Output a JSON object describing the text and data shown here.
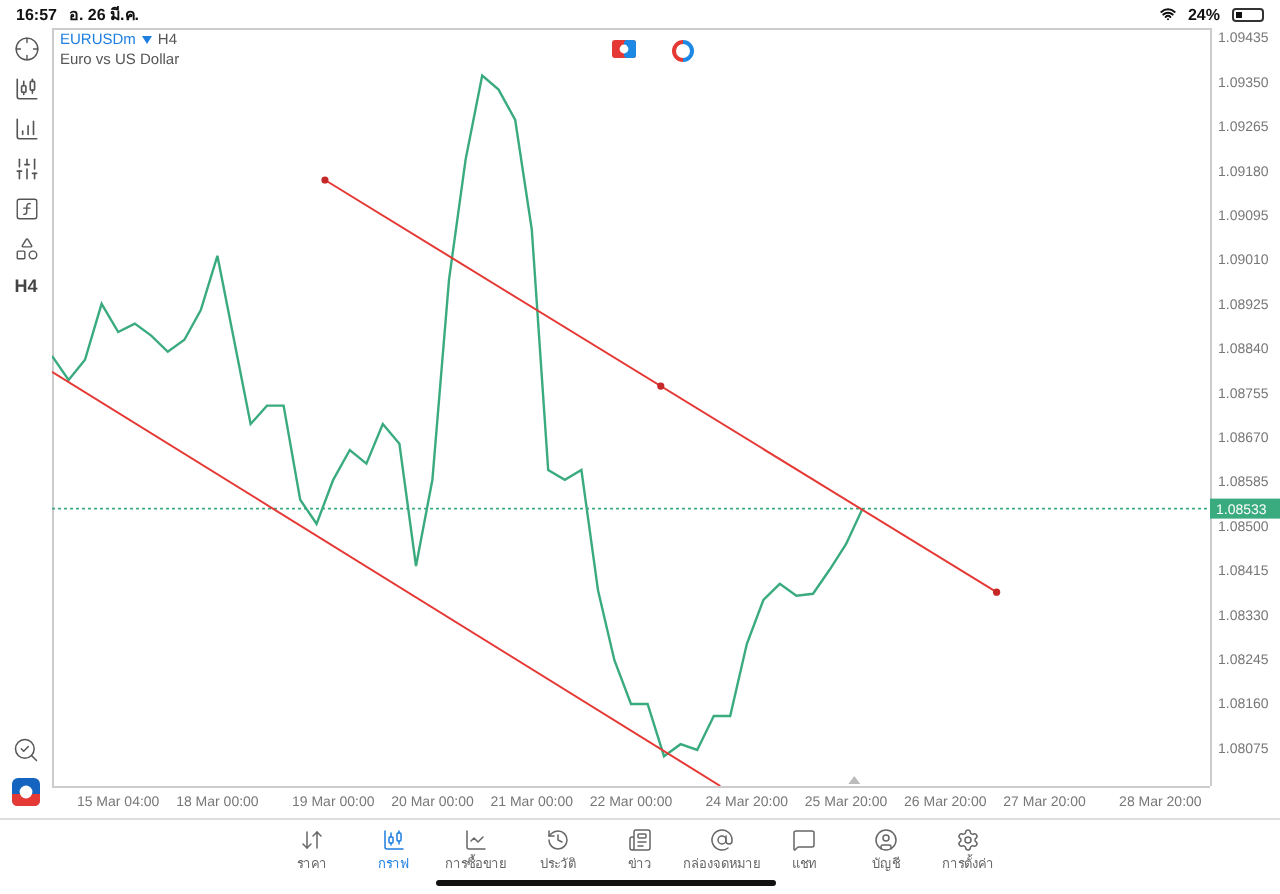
{
  "status_bar": {
    "time": "16:57",
    "date": "อ. 26 มี.ค.",
    "battery": "24%"
  },
  "toolbar": {
    "timeframe": "H4"
  },
  "chart": {
    "timeframe": "H4",
    "description": "Euro vs US Dollar",
    "trendlines": [
      {
        "handles": false
      },
      {
        "handles": true
      }
    ],
    "chart_data": {
      "type": "line",
      "series": [
        {
          "name": "EURUSDm",
          "color": "#3aaa7f",
          "values": [
            1.08825,
            1.08779,
            1.08818,
            1.08925,
            1.08871,
            1.08887,
            1.08864,
            1.08833,
            1.08856,
            1.08913,
            1.09017,
            1.08856,
            1.08695,
            1.0873,
            1.0873,
            1.0855,
            1.08504,
            1.08588,
            1.08645,
            1.08619,
            1.08695,
            1.08657,
            1.08423,
            1.08588,
            1.08971,
            1.09201,
            1.09362,
            1.09335,
            1.09277,
            1.09067,
            1.08607,
            1.08588,
            1.08607,
            1.08377,
            1.08243,
            1.08159,
            1.08159,
            1.08059,
            1.08082,
            1.08071,
            1.08136,
            1.08136,
            1.08274,
            1.08358,
            1.08389,
            1.08366,
            1.0837,
            1.08416,
            1.08465,
            1.08533,
            null,
            null,
            null,
            null,
            null,
            null,
            null,
            null,
            null,
            null,
            null,
            null,
            null,
            null,
            null,
            null,
            null,
            null,
            null,
            null,
            null
          ]
        }
      ],
      "categories": [
        null,
        null,
        null,
        null,
        "15 Mar 04:00",
        null,
        null,
        null,
        null,
        null,
        "18 Mar 00:00",
        null,
        null,
        null,
        null,
        null,
        null,
        "19 Mar 00:00",
        null,
        null,
        null,
        null,
        null,
        "20 Mar 00:00",
        null,
        null,
        null,
        null,
        null,
        "21 Mar 00:00",
        null,
        null,
        null,
        null,
        null,
        "22 Mar 00:00",
        null,
        null,
        null,
        null,
        null,
        null,
        "24 Mar 20:00",
        null,
        null,
        null,
        null,
        null,
        "25 Mar 20:00",
        null,
        null,
        null,
        null,
        null,
        "26 Mar 20:00",
        null,
        null,
        null,
        null,
        null,
        "27 Mar 20:00",
        null,
        null,
        null,
        null,
        null,
        null,
        "28 Mar 20:00",
        null,
        null,
        null
      ],
      "ylim": [
        1.08002,
        1.09453
      ],
      "yticks": [
        {
          "value": 1.09435,
          "label": "1.09435"
        },
        {
          "value": 1.0935,
          "label": "1.09350"
        },
        {
          "value": 1.09265,
          "label": "1.09265"
        },
        {
          "value": 1.0918,
          "label": "1.09180"
        },
        {
          "value": 1.09095,
          "label": "1.09095"
        },
        {
          "value": 1.0901,
          "label": "1.09010"
        },
        {
          "value": 1.08925,
          "label": "1.08925"
        },
        {
          "value": 1.0884,
          "label": "1.08840"
        },
        {
          "value": 1.08755,
          "label": "1.08755"
        },
        {
          "value": 1.0867,
          "label": "1.08670"
        },
        {
          "value": 1.08585,
          "label": "1.08585"
        },
        {
          "value": 1.085,
          "label": "1.08500"
        },
        {
          "value": 1.08415,
          "label": "1.08415"
        },
        {
          "value": 1.0833,
          "label": "1.08330"
        },
        {
          "value": 1.08245,
          "label": "1.08245"
        },
        {
          "value": 1.0816,
          "label": "1.08160"
        },
        {
          "value": 1.08075,
          "label": "1.08075"
        }
      ],
      "ref_lines": [
        {
          "axis": "y",
          "value": 1.08533,
          "label": "1.08533"
        }
      ]
    }
  },
  "tabs": [
    {
      "label": "ราคา",
      "selected": false
    },
    {
      "label": "กราฟ",
      "selected": true
    },
    {
      "label": "การซื้อขาย",
      "selected": false
    },
    {
      "label": "ประวัติ",
      "selected": false
    },
    {
      "label": "ข่าว",
      "selected": false
    },
    {
      "label": "กล่องจดหมาย",
      "selected": false
    },
    {
      "label": "แชท",
      "selected": false
    },
    {
      "label": "บัญชี",
      "selected": false
    },
    {
      "label": "การตั้งค่า",
      "selected": false
    }
  ]
}
